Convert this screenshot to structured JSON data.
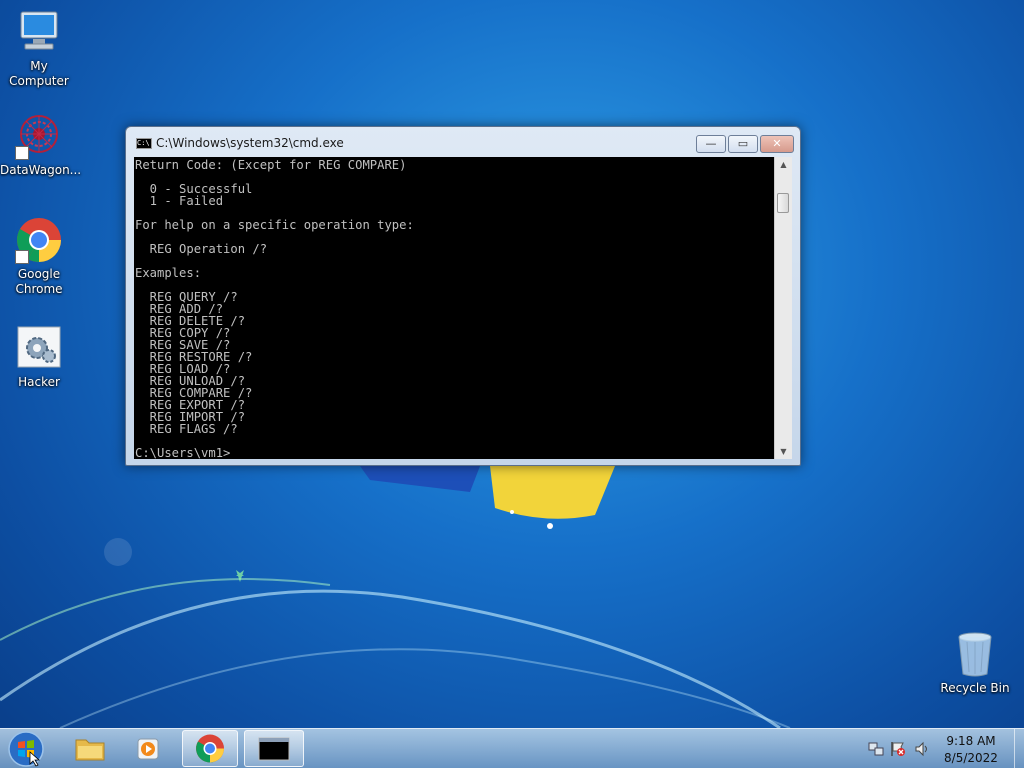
{
  "desktop": {
    "icons": [
      {
        "label": "My Computer"
      },
      {
        "label": "DataWagon..."
      },
      {
        "label": "Google Chrome"
      },
      {
        "label": "Hacker"
      },
      {
        "label": "Recycle Bin"
      }
    ]
  },
  "window": {
    "title": "C:\\Windows\\system32\\cmd.exe",
    "minimize_glyph": "—",
    "maximize_glyph": "▭",
    "close_glyph": "✕",
    "console_lines": [
      "Return Code: (Except for REG COMPARE)",
      "",
      "  0 - Successful",
      "  1 - Failed",
      "",
      "For help on a specific operation type:",
      "",
      "  REG Operation /?",
      "",
      "Examples:",
      "",
      "  REG QUERY /?",
      "  REG ADD /?",
      "  REG DELETE /?",
      "  REG COPY /?",
      "  REG SAVE /?",
      "  REG RESTORE /?",
      "  REG LOAD /?",
      "  REG UNLOAD /?",
      "  REG COMPARE /?",
      "  REG EXPORT /?",
      "  REG IMPORT /?",
      "  REG FLAGS /?",
      "",
      "C:\\Users\\vm1>"
    ],
    "scroll_up_glyph": "▲",
    "scroll_down_glyph": "▼"
  },
  "taskbar": {
    "pinned": [
      "Windows Explorer",
      "Windows Media Player",
      "Google Chrome",
      "Command Prompt"
    ],
    "cmd_icon_text": "C:\\_",
    "clock": {
      "time": "9:18 AM",
      "date": "8/5/2022"
    }
  },
  "colors": {
    "console_bg": "#000000",
    "console_fg": "#c0c0c0",
    "desktop_bg": "#1670c9"
  }
}
